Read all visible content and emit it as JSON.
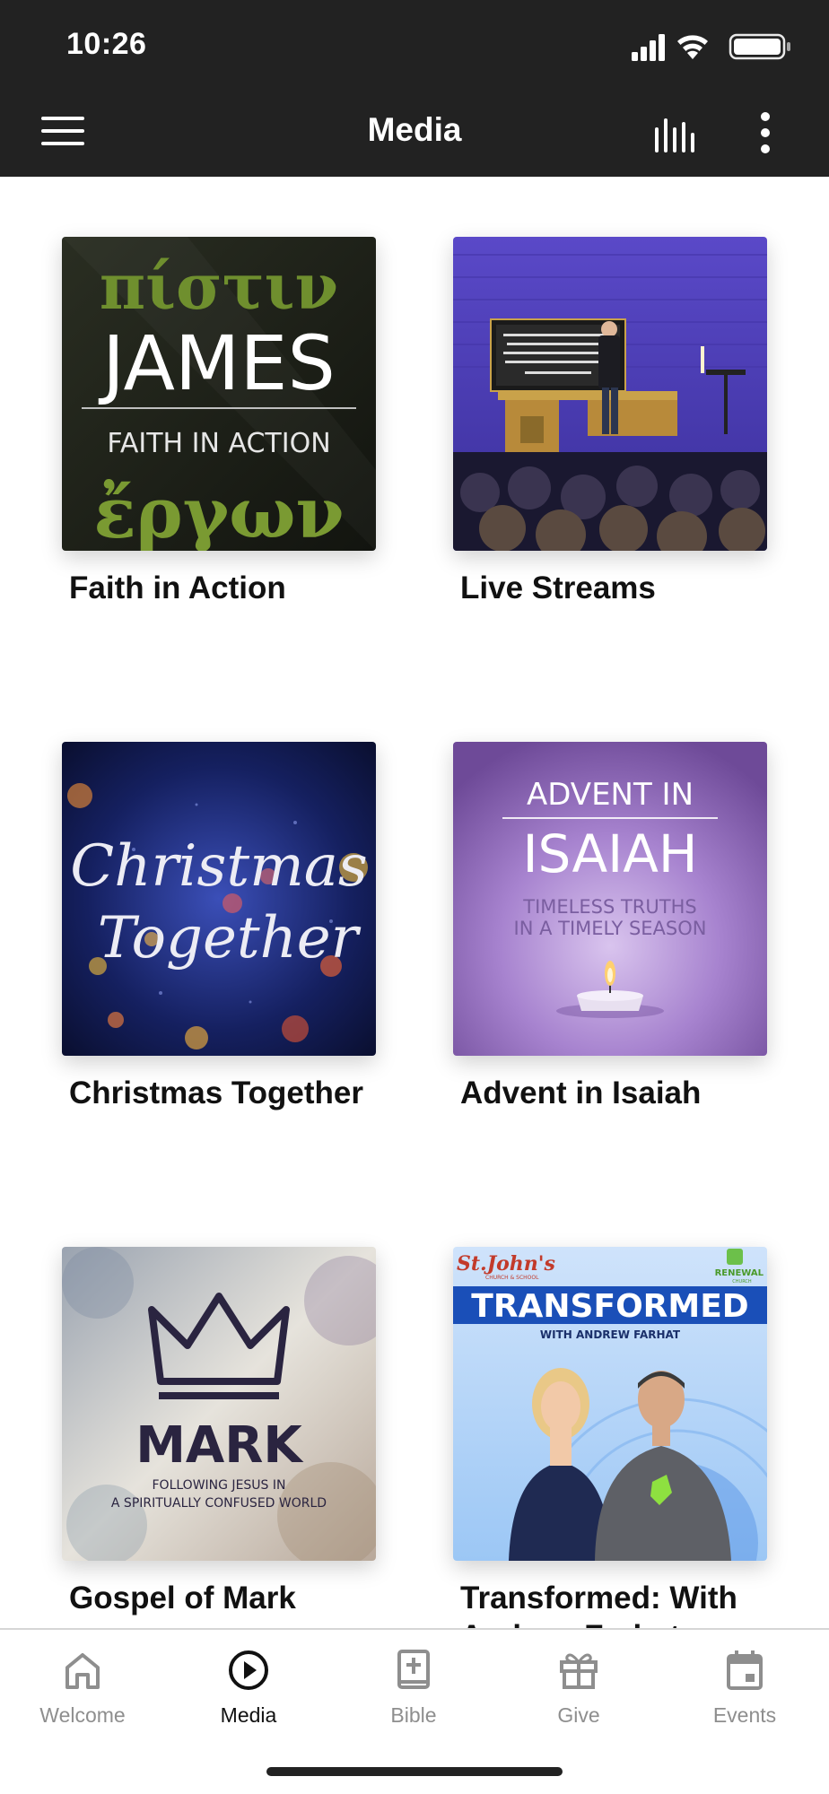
{
  "status": {
    "time": "10:26"
  },
  "header": {
    "title": "Media"
  },
  "cards": [
    {
      "title": "Faith in Action",
      "art": {
        "top": "πίστιν",
        "main": "JAMES",
        "sub": "FAITH IN ACTION",
        "bottom": "ἔργων"
      }
    },
    {
      "title": "Live Streams",
      "art": {
        "screen_text": "\"Certainly, you will not release a stronger incense or other repellent against the devil than to be engaged by God's commandments and words and speak, sing, or think them.\" -Luther's Large Catechism"
      }
    },
    {
      "title": "Christmas Together",
      "art": {
        "line1": "Christmas",
        "line2": "Together"
      }
    },
    {
      "title": "Advent in Isaiah",
      "art": {
        "top": "ADVENT IN",
        "main": "ISAIAH",
        "sub1": "TIMELESS TRUTHS",
        "sub2": "IN A TIMELY SEASON"
      }
    },
    {
      "title": "Gospel of Mark",
      "art": {
        "main": "MARK",
        "sub1": "FOLLOWING JESUS IN",
        "sub2": "A SPIRITUALLY CONFUSED WORLD"
      }
    },
    {
      "title": "Transformed: With Andrew Farhat",
      "art": {
        "brand": "St.John's",
        "brand_sub": "CHURCH & SCHOOL",
        "renewal": "RENEWAL",
        "renewal_sub": "CHURCH",
        "main": "TRANSFORMED",
        "sub": "WITH ANDREW FARHAT"
      }
    }
  ],
  "nav": [
    {
      "label": "Welcome",
      "icon": "home-icon",
      "active": false
    },
    {
      "label": "Media",
      "icon": "play-circle-icon",
      "active": true
    },
    {
      "label": "Bible",
      "icon": "bible-icon",
      "active": false
    },
    {
      "label": "Give",
      "icon": "gift-icon",
      "active": false
    },
    {
      "label": "Events",
      "icon": "calendar-icon",
      "active": false
    }
  ],
  "colors": {
    "header_bg": "#222222",
    "active_nav": "#111111",
    "inactive_nav": "#8e8e8e"
  }
}
